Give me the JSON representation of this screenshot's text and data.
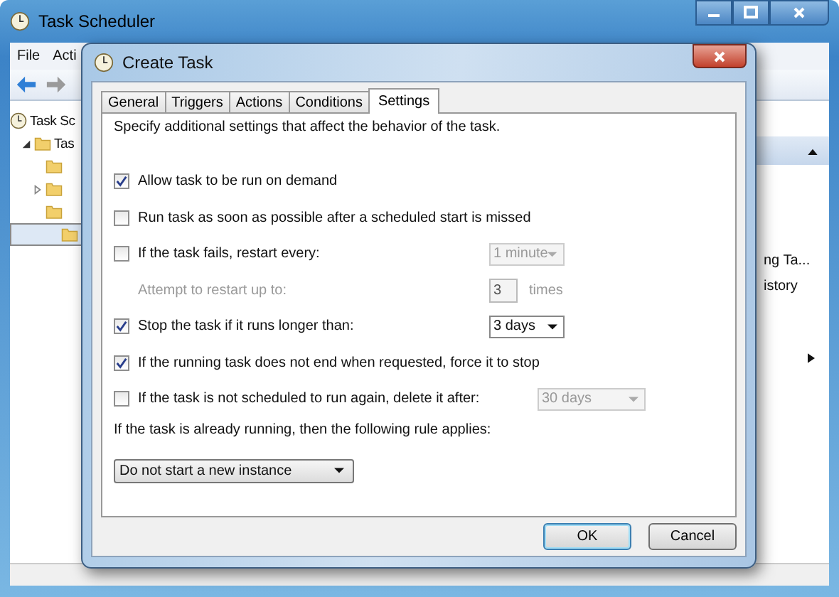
{
  "main_window": {
    "title": "Task Scheduler",
    "menu": [
      "File",
      "Acti"
    ],
    "tree": [
      {
        "label": "Task Sc",
        "children": [
          {
            "label": "Tas",
            "expanded": true,
            "children": [
              {
                "selected": false
              },
              {
                "expanded": false,
                "selected": false
              },
              {
                "selected": false
              },
              {
                "selected": true
              }
            ]
          }
        ]
      }
    ],
    "actions_pane": [
      "ng Ta...",
      "istory"
    ]
  },
  "dialog": {
    "title": "Create Task",
    "tabs": [
      {
        "label": "General",
        "selected": false
      },
      {
        "label": "Triggers",
        "selected": false
      },
      {
        "label": "Actions",
        "selected": false
      },
      {
        "label": "Conditions",
        "selected": false
      },
      {
        "label": "Settings",
        "selected": true
      }
    ],
    "description": "Specify additional settings that affect the behavior of the task.",
    "options": [
      {
        "kind": "checkbox",
        "label": "Allow task to be run on demand",
        "checked": true
      },
      {
        "kind": "checkbox",
        "label": "Run task as soon as possible after a scheduled start is missed",
        "checked": false
      },
      {
        "kind": "checkbox",
        "label": "If the task fails, restart every:",
        "checked": false,
        "select": {
          "value": "1 minute",
          "disabled": true
        }
      },
      {
        "kind": "spin",
        "label": "Attempt to restart up to:",
        "value": "3",
        "unit": "times",
        "disabled": true
      },
      {
        "kind": "checkbox",
        "label": "Stop the task if it runs longer than:",
        "checked": true,
        "select": {
          "value": "3 days",
          "disabled": false
        }
      },
      {
        "kind": "checkbox",
        "label": "If the running task does not end when requested, force it to stop",
        "checked": true
      },
      {
        "kind": "checkbox",
        "label": "If the task is not scheduled to run again, delete it after:",
        "checked": false,
        "select": {
          "value": "30 days",
          "disabled": true
        }
      }
    ],
    "rule_label": "If the task is already running, then the following rule applies:",
    "rule_select": "Do not start a new instance",
    "buttons": [
      {
        "label": "OK",
        "default": true
      },
      {
        "label": "Cancel",
        "default": false
      }
    ]
  }
}
